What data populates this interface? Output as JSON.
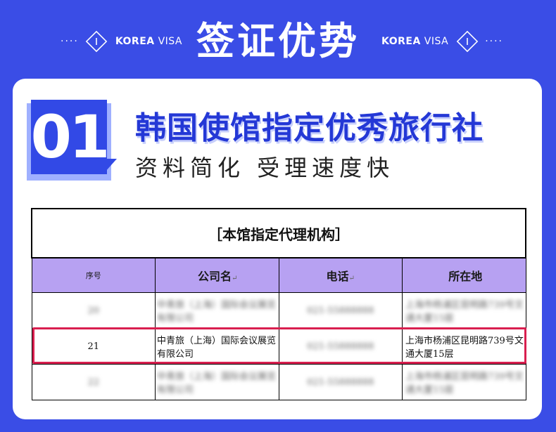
{
  "header": {
    "title": "签证优势",
    "left_dots": "····",
    "right_dots": "····",
    "brand_bold": "KOREA",
    "brand_light": "VISA"
  },
  "section": {
    "number": "01",
    "title": "韩国使馆指定优秀旅行社",
    "subtitle": "资料简化 受理速度快"
  },
  "table": {
    "title": "［本馆指定代理机构］",
    "headers": [
      "序号",
      "公司名",
      "电话",
      "所在地"
    ],
    "header_mark": "↵",
    "rows": [
      {
        "no": "20",
        "company": "中青旅（上海）国际会议展览有限公司",
        "phone": "021-55888888",
        "address": "上海市杨浦区昆明路739号文通大厦15层",
        "blurred": true
      },
      {
        "no": "21",
        "company": "中青旅（上海）国际会议展览有限公司",
        "phone": "021-55888888",
        "address": "上海市杨浦区昆明路739号文通大厦15层",
        "blurred": false,
        "phone_blurred": true
      },
      {
        "no": "22",
        "company": "中青旅（上海）国际会议展览有限公司",
        "phone": "021-55888888",
        "address": "上海市杨浦区昆明路739号文通大厦15层",
        "blurred": true
      }
    ]
  },
  "colors": {
    "background": "#3a4de6",
    "accent": "#2438d6",
    "header_row": "#b7a1f2",
    "highlight": "#d91f4f"
  }
}
